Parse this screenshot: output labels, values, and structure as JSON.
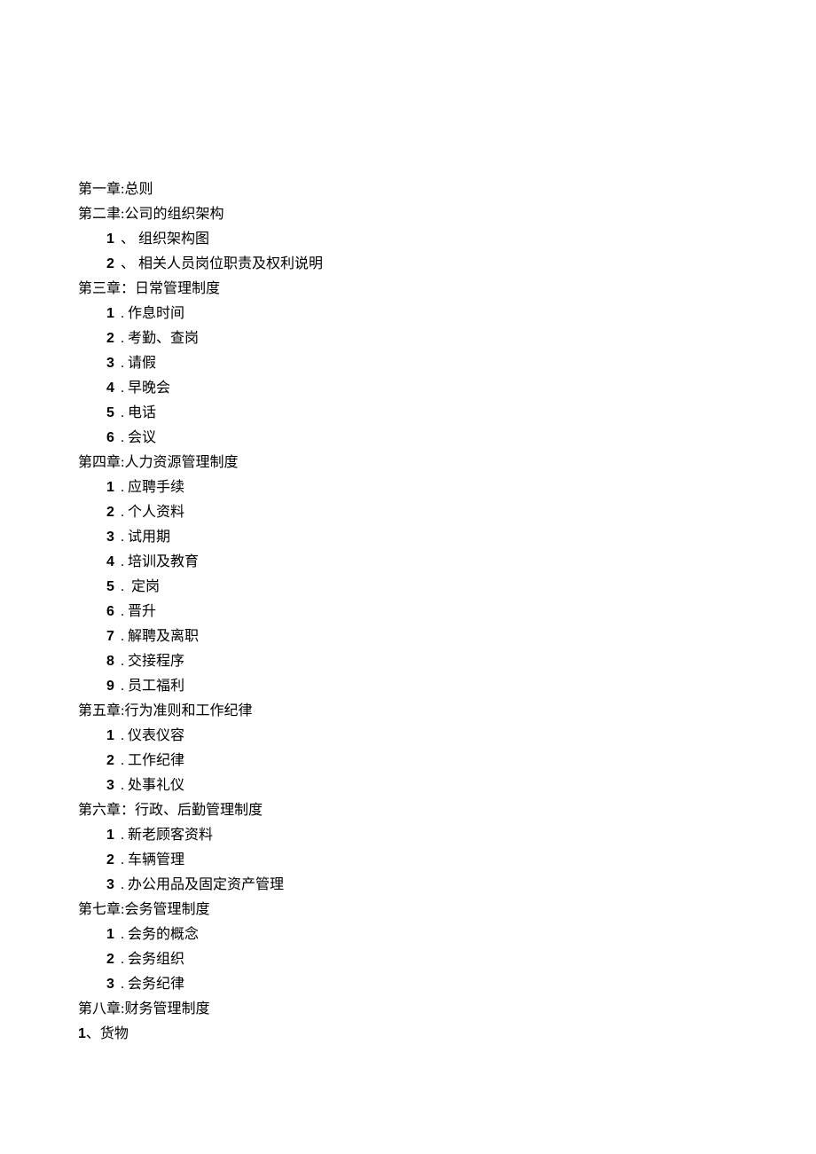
{
  "chapters": [
    {
      "title": "第一章:总则",
      "items": []
    },
    {
      "title": "第二聿:公司的组织架构",
      "items": [
        {
          "num": "1",
          "sep": "、",
          "sepClass": "sep-dun",
          "text": "组织架构图"
        },
        {
          "num": "2",
          "sep": "、",
          "sepClass": "sep-dun",
          "text": "相关人员岗位职责及权利说明"
        }
      ]
    },
    {
      "title": "第三章：日常管理制度",
      "items": [
        {
          "num": "1",
          "sep": ".",
          "sepClass": "sep-dot",
          "text": "作息时间"
        },
        {
          "num": "2",
          "sep": ".",
          "sepClass": "sep-dot",
          "text": "考勤、查岗"
        },
        {
          "num": "3",
          "sep": ".",
          "sepClass": "sep-dot",
          "text": "请假"
        },
        {
          "num": "4",
          "sep": ".",
          "sepClass": "sep-dot",
          "text": "早晚会"
        },
        {
          "num": "5",
          "sep": ".",
          "sepClass": "sep-dot",
          "text": "电话"
        },
        {
          "num": "6",
          "sep": ".",
          "sepClass": "sep-dot",
          "text": "会议"
        }
      ]
    },
    {
      "title": "第四章:人力资源管理制度",
      "items": [
        {
          "num": "1",
          "sep": ".",
          "sepClass": "sep-dot",
          "text": "应聘手续"
        },
        {
          "num": "2",
          "sep": ".",
          "sepClass": "sep-dot",
          "text": "个人资料"
        },
        {
          "num": "3",
          "sep": ".",
          "sepClass": "sep-dot",
          "text": "试用期"
        },
        {
          "num": "4",
          "sep": ".",
          "sepClass": "sep-dot",
          "text": "培训及教育"
        },
        {
          "num": "5",
          "sep": ". ",
          "sepClass": "sep-dot",
          "text": "定岗"
        },
        {
          "num": "6",
          "sep": ".",
          "sepClass": "sep-dot",
          "text": "晋升"
        },
        {
          "num": "7",
          "sep": ".",
          "sepClass": "sep-dot",
          "text": "解聘及离职"
        },
        {
          "num": "8",
          "sep": ".",
          "sepClass": "sep-dot",
          "text": "交接程序"
        },
        {
          "num": "9",
          "sep": ".",
          "sepClass": "sep-dot",
          "text": "员工福利"
        }
      ]
    },
    {
      "title": "第五章:行为准则和工作纪律",
      "items": [
        {
          "num": "1",
          "sep": ".",
          "sepClass": "sep-dot",
          "text": "仪表仪容"
        },
        {
          "num": "2",
          "sep": ".",
          "sepClass": "sep-dot",
          "text": "工作纪律"
        },
        {
          "num": "3",
          "sep": ".",
          "sepClass": "sep-dot",
          "text": "处事礼仪"
        }
      ]
    },
    {
      "title": "第六章：行政、后勤管理制度",
      "items": [
        {
          "num": "1",
          "sep": ".",
          "sepClass": "sep-dot",
          "text": "新老顾客资料"
        },
        {
          "num": "2",
          "sep": ".",
          "sepClass": "sep-dot",
          "text": "车辆管理"
        },
        {
          "num": "3",
          "sep": ".",
          "sepClass": "sep-dot",
          "text": "办公用品及固定资产管理"
        }
      ]
    },
    {
      "title": "第七章:会务管理制度",
      "items": [
        {
          "num": "1",
          "sep": ".",
          "sepClass": "sep-dot",
          "text": "会务的概念"
        },
        {
          "num": "2",
          "sep": ".",
          "sepClass": "sep-dot",
          "text": "会务组织"
        },
        {
          "num": "3",
          "sep": ".",
          "sepClass": "sep-dot",
          "text": "会务纪律"
        }
      ]
    },
    {
      "title": "第八章:财务管理制度",
      "items": []
    }
  ],
  "ch8_sub": {
    "num": "1",
    "sep": "、",
    "text": "货物"
  }
}
